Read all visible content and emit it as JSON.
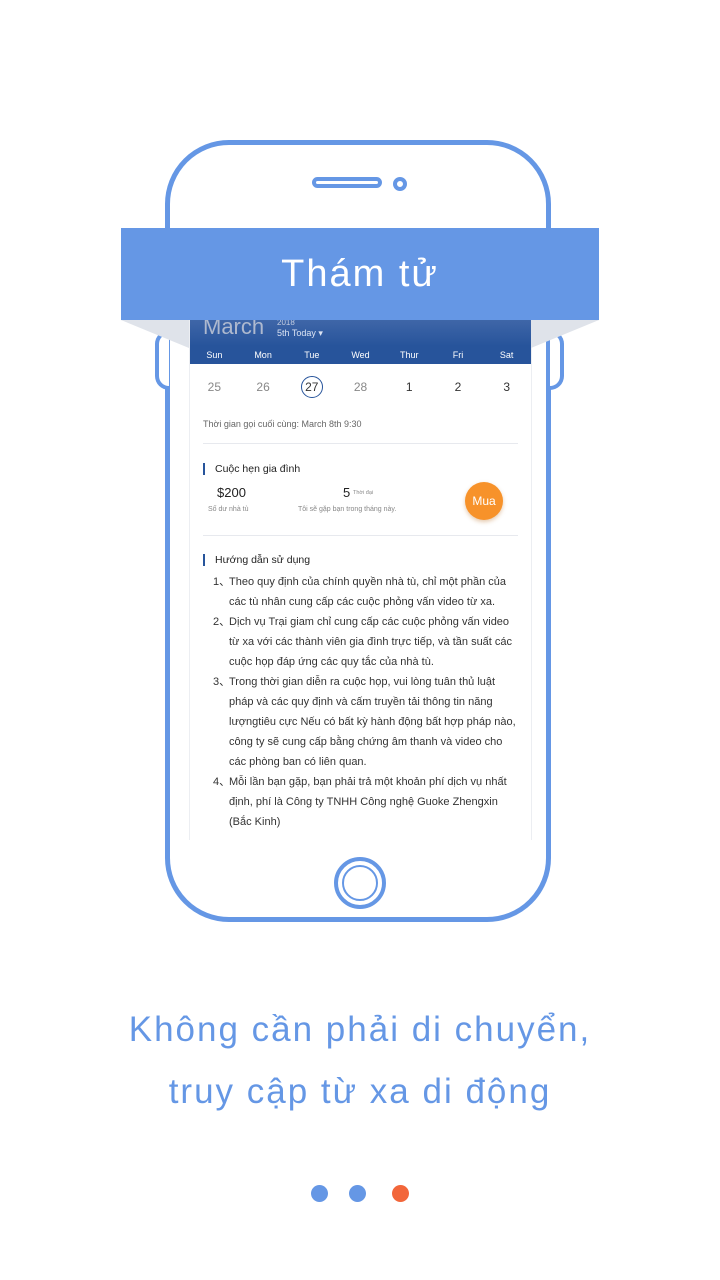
{
  "banner": {
    "title": "Thám tử"
  },
  "calendar": {
    "month": "March",
    "year": "2018",
    "today_label": "5th  Today ▾",
    "weekdays": [
      "Sun",
      "Mon",
      "Tue",
      "Wed",
      "Thur",
      "Fri",
      "Sat"
    ],
    "days": [
      "25",
      "26",
      "27",
      "28",
      "1",
      "2",
      "3"
    ],
    "selected_day": "27"
  },
  "last_call": "Thời gian gọi cuối cùng:  March 8th 9:30",
  "family_appointment": {
    "title": "Cuộc hẹn gia đình",
    "balance_value": "$200",
    "balance_label": "Số dư nhà tù",
    "count_value": "5",
    "count_unit": "Thời đại",
    "count_label": "Tôi sẽ gặp bạn trong tháng này.",
    "buy_label": "Mua"
  },
  "guide": {
    "title": "Hướng dẫn sử dụng",
    "items": [
      {
        "num": "1、",
        "text": "Theo quy định của chính quyền nhà tù, chỉ một phần của các tù nhân cung cấp các cuộc phỏng vấn video từ xa."
      },
      {
        "num": "2、",
        "text": "Dịch vụ Trại giam chỉ cung cấp các cuộc phỏng vấn video từ xa với các thành viên gia đình trực tiếp, và tần suất các cuộc họp đáp ứng các quy tắc của nhà tù."
      },
      {
        "num": "3、",
        "text": "Trong thời gian diễn ra cuộc họp, vui lòng tuân thủ luật pháp và các quy định và cấm truyền tải thông tin năng lượngtiêu cực Nếu có bất kỳ hành động bất hợp pháp nào, công ty sẽ cung cấp bằng chứng âm thanh và video cho các phòng ban có liên quan."
      },
      {
        "num": "4、",
        "text": "Mỗi lần bạn gặp, bạn phải trả một khoản phí dịch vụ nhất định, phí là Công ty TNHH Công nghệ Guoke Zhengxin (Bắc Kinh)"
      }
    ]
  },
  "caption": {
    "line1": "Không cần phải di chuyển,",
    "line2": "truy cập từ xa di động"
  },
  "pager": {
    "active_index": 2,
    "colors": {
      "inactive": "#6597e5",
      "active": "#f2663a"
    }
  },
  "colors": {
    "accent": "#6597e5",
    "calendar_header": "#27549b",
    "buy_button": "#f7922a"
  }
}
